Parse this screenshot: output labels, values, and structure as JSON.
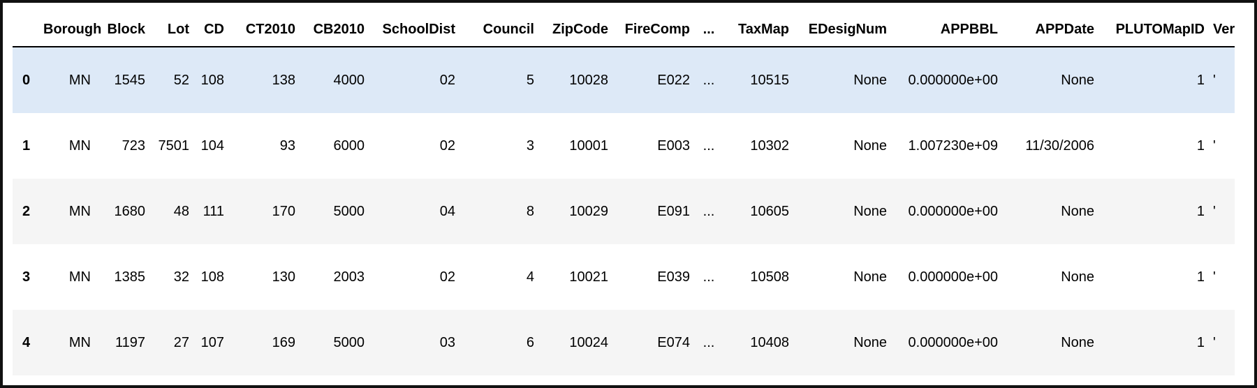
{
  "table": {
    "columns": [
      "Borough",
      "Block",
      "Lot",
      "CD",
      "CT2010",
      "CB2010",
      "SchoolDist",
      "Council",
      "ZipCode",
      "FireComp",
      "...",
      "TaxMap",
      "EDesigNum",
      "APPBBL",
      "APPDate",
      "PLUTOMapID",
      "Ver"
    ],
    "rows": [
      {
        "index": "0",
        "cells": [
          "MN",
          "1545",
          "52",
          "108",
          "138",
          "4000",
          "02",
          "5",
          "10028",
          "E022",
          "...",
          "10515",
          "None",
          "0.000000e+00",
          "None",
          "1",
          "'"
        ]
      },
      {
        "index": "1",
        "cells": [
          "MN",
          "723",
          "7501",
          "104",
          "93",
          "6000",
          "02",
          "3",
          "10001",
          "E003",
          "...",
          "10302",
          "None",
          "1.007230e+09",
          "11/30/2006",
          "1",
          "'"
        ]
      },
      {
        "index": "2",
        "cells": [
          "MN",
          "1680",
          "48",
          "111",
          "170",
          "5000",
          "04",
          "8",
          "10029",
          "E091",
          "...",
          "10605",
          "None",
          "0.000000e+00",
          "None",
          "1",
          "'"
        ]
      },
      {
        "index": "3",
        "cells": [
          "MN",
          "1385",
          "32",
          "108",
          "130",
          "2003",
          "02",
          "4",
          "10021",
          "E039",
          "...",
          "10508",
          "None",
          "0.000000e+00",
          "None",
          "1",
          "'"
        ]
      },
      {
        "index": "4",
        "cells": [
          "MN",
          "1197",
          "27",
          "107",
          "169",
          "5000",
          "03",
          "6",
          "10024",
          "E074",
          "...",
          "10408",
          "None",
          "0.000000e+00",
          "None",
          "1",
          "'"
        ]
      }
    ],
    "hovered_row": 0,
    "colors": {
      "header_border": "#000000",
      "row_stripe": "#f5f5f5",
      "row_plain": "#ffffff",
      "row_hover": "#dde9f7",
      "frame_border": "#111111"
    }
  }
}
